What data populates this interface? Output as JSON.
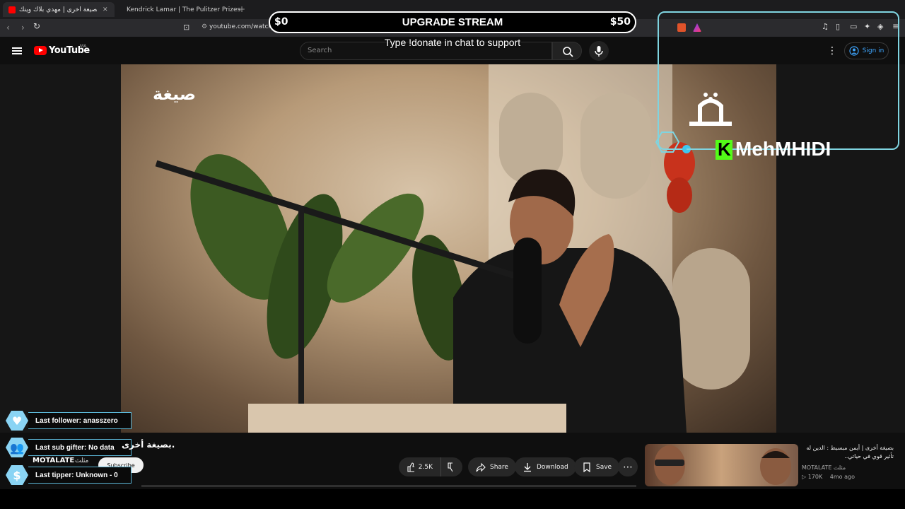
{
  "browser": {
    "tabs": [
      {
        "title": "بصيغة أخرى | مهدي بلاك وينك",
        "active": true
      },
      {
        "title": "Kendrick Lamar | The Pulitzer Prizes",
        "active": false
      }
    ],
    "url": "youtube.com/watch?v=8ybW-pgkYPA"
  },
  "youtube": {
    "logo_text": "YouTube",
    "region": "MA",
    "search_placeholder": "Search",
    "signin_label": "Sign in"
  },
  "overlay": {
    "goal_left": "$0",
    "goal_title": "UPGRADE STREAM",
    "goal_right": "$50",
    "donate_text": "Type !donate in chat to support",
    "streamer_name": "MehMHIDI",
    "widgets": [
      {
        "text": "Last follower: anasszero",
        "icon": "heart-icon"
      },
      {
        "text": "Last sub gifter: No data",
        "icon": "users-icon"
      },
      {
        "text": "Last tipper: Unknown - 0",
        "icon": "dollar-icon"
      }
    ]
  },
  "video": {
    "title": "بصيغة أخرى.",
    "channel": "MOTALATE",
    "channel_ar": "مثلث",
    "subscribe_label": "Subscribe"
  },
  "actions": {
    "likes": "2.5K",
    "share": "Share",
    "download": "Download",
    "save": "Save"
  },
  "recommended": {
    "title": "بصيغة أخرى | أيمن مبسيط : الدين له تأثير قوي في حياتي..",
    "channel": "MOTALATE مثلث",
    "views": "170K",
    "age": "4mo ago"
  },
  "colors": {
    "accent_blue": "#3ea6ff",
    "youtube_red": "#ff0000",
    "overlay_cyan": "#7fd4e0",
    "kick_green": "#53fc18"
  }
}
